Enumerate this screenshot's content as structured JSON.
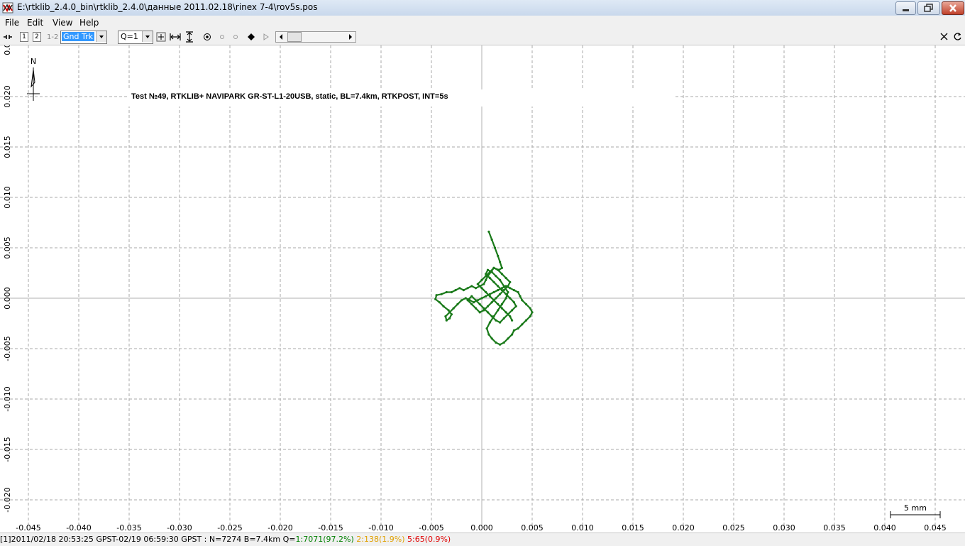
{
  "window": {
    "title": "E:\\rtklib_2.4.0_bin\\rtklib_2.4.0\\данные 2011.02.18\\rinex 7-4\\rov5s.pos"
  },
  "menu": {
    "file": "File",
    "edit": "Edit",
    "view": "View",
    "help": "Help"
  },
  "toolbar": {
    "btn1": "1",
    "btn2": "2",
    "btn12": "1-2",
    "plot_type": "Gnd Trk",
    "quality": "Q=1"
  },
  "plot": {
    "annotation": "Test №49, RTKLIB+ NAVIPARK GR-ST-L1-20USB, static, BL=7.4km, RTKPOST, INT=5s",
    "compass_label": "N",
    "scale_label": "5 mm"
  },
  "status": {
    "prefix": "[1]2011/02/18 20:53:25 GPST-02/19 06:59:30 GPST : N=7274 B=7.4km Q=",
    "q1": "1:7071(97.2%)",
    "q2": "2:138(1.9%)",
    "q5": "5:65(0.9%)",
    "colors": {
      "q1": "#008000",
      "q2": "#e0a000",
      "q5": "#e00000"
    }
  },
  "colors": {
    "track": "#1a7a1a",
    "grid": "#a0a0a0"
  },
  "chart_data": {
    "type": "scatter",
    "title": "",
    "xlabel": "",
    "ylabel": "",
    "xlim": [
      -0.047,
      0.048
    ],
    "ylim": [
      -0.0222,
      0.0248
    ],
    "x_ticks": [
      "-0.045",
      "-0.040",
      "-0.035",
      "-0.030",
      "-0.025",
      "-0.020",
      "-0.015",
      "-0.010",
      "-0.005",
      "0.000",
      "0.005",
      "0.010",
      "0.015",
      "0.020",
      "0.025",
      "0.030",
      "0.035",
      "0.040",
      "0.045"
    ],
    "y_ticks": [
      "0.0",
      "0.020",
      "0.015",
      "0.010",
      "0.005",
      "0.000",
      "-0.005",
      "-0.010",
      "-0.015",
      "-0.020"
    ],
    "grid": true,
    "series": [
      {
        "color": "#1a7a1a",
        "x": [
          0.0007,
          0.001,
          0.0013,
          0.0016,
          0.0018,
          0.002,
          0.0017,
          0.0012,
          0.0009,
          0.0006,
          0.0004,
          0.0002,
          -0.0002,
          -0.0006,
          -0.001,
          -0.0014,
          -0.0018,
          -0.0022,
          -0.0026,
          -0.003,
          -0.0035,
          -0.004,
          -0.0045,
          -0.0046,
          -0.0042,
          -0.0038,
          -0.0033,
          -0.003,
          -0.0032,
          -0.0035,
          -0.0036,
          -0.0032,
          -0.0028,
          -0.0024,
          -0.002,
          -0.0016,
          -0.0012,
          -0.0008,
          -0.0004,
          0.0,
          0.0004,
          0.0008,
          0.0012,
          0.0016,
          0.002,
          0.0024,
          0.0028,
          0.0032,
          0.0036,
          0.0038,
          0.004,
          0.0044,
          0.0048,
          0.005,
          0.0048,
          0.0044,
          0.004,
          0.0036,
          0.0032,
          0.003,
          0.0026,
          0.0022,
          0.0018,
          0.0014,
          0.001,
          0.0007,
          0.0005,
          0.0008,
          0.0012,
          0.0016,
          0.002,
          0.0024,
          0.0026,
          0.0022,
          0.0018,
          0.0014,
          0.001,
          0.0006,
          0.0004,
          0.0008,
          0.0012,
          0.0016,
          0.002,
          0.0024,
          0.0028,
          0.0032,
          0.0034,
          0.003,
          0.0026,
          0.0022,
          0.0018,
          0.0014,
          0.001,
          0.0006,
          0.0002,
          -0.0002,
          -0.0006,
          -0.001,
          -0.0014,
          -0.001,
          -0.0006,
          -0.0002,
          0.0002,
          0.0006,
          0.001,
          0.0014,
          0.0018,
          0.0022,
          0.0026,
          0.0028,
          0.0024,
          0.002,
          0.0016,
          0.0012,
          0.0008,
          0.0004,
          0.0,
          -0.0004,
          0.0,
          0.0004,
          0.0008,
          0.0012,
          0.0016,
          0.002,
          0.0024,
          0.0028,
          0.003
        ],
        "y": [
          0.0066,
          0.0058,
          0.005,
          0.0042,
          0.0036,
          0.003,
          0.0028,
          0.003,
          0.0026,
          0.0022,
          0.0018,
          0.0014,
          0.0012,
          0.001,
          0.0012,
          0.001,
          0.0008,
          0.001,
          0.0008,
          0.0006,
          0.0006,
          0.0004,
          0.0003,
          -0.0001,
          -0.0004,
          -0.0008,
          -0.0012,
          -0.0016,
          -0.002,
          -0.0022,
          -0.0018,
          -0.0014,
          -0.001,
          -0.0006,
          -0.0002,
          0.0,
          -0.0002,
          -0.0004,
          -0.0002,
          0.0,
          0.0002,
          0.0004,
          0.0006,
          0.0008,
          0.001,
          0.0012,
          0.001,
          0.0008,
          0.0006,
          0.0002,
          -0.0002,
          -0.0006,
          -0.001,
          -0.0014,
          -0.0018,
          -0.0022,
          -0.0026,
          -0.003,
          -0.0032,
          -0.0036,
          -0.004,
          -0.0044,
          -0.0046,
          -0.0044,
          -0.004,
          -0.0036,
          -0.003,
          -0.0024,
          -0.0018,
          -0.0012,
          -0.0006,
          0.0,
          0.0006,
          0.0012,
          0.0018,
          0.0022,
          0.0026,
          0.0028,
          0.0024,
          0.002,
          0.0016,
          0.0012,
          0.0008,
          0.0004,
          0.0,
          -0.0004,
          -0.0008,
          -0.0012,
          -0.0016,
          -0.002,
          -0.0024,
          -0.0022,
          -0.0018,
          -0.0014,
          -0.001,
          -0.0006,
          -0.0002,
          0.0002,
          -0.0002,
          -0.0006,
          -0.001,
          -0.0014,
          -0.0012,
          -0.0008,
          -0.0004,
          0.0,
          0.0004,
          0.0008,
          0.0012,
          0.0016,
          0.002,
          0.0024,
          0.0028,
          0.003,
          0.0026,
          0.0022,
          0.0018,
          0.0014,
          0.001,
          0.0006,
          0.0002,
          -0.0002,
          -0.0006,
          -0.001,
          -0.0014,
          -0.0018,
          -0.0022
        ]
      }
    ]
  }
}
